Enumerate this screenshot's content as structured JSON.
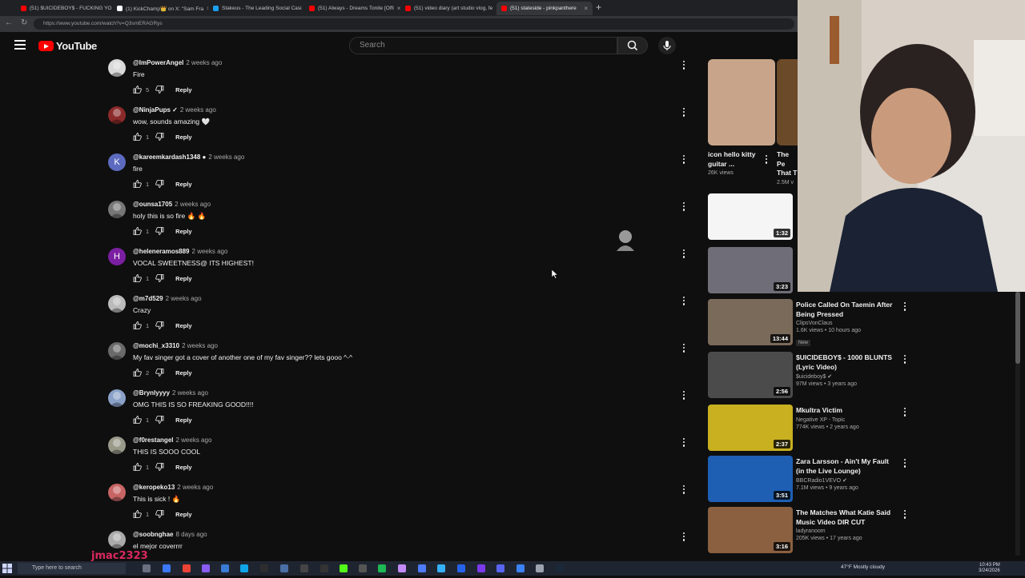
{
  "browser": {
    "tabs": [
      {
        "label": "(51) $UICIDEBOY$ - FUCKING YO",
        "color": "#ff0000",
        "active": false
      },
      {
        "label": "(1) KickChamp👑 on X: \"Sam Fra",
        "color": "#ffffff",
        "active": false
      },
      {
        "label": "Stakeus - The Leading Social Casi",
        "color": "#1da1f2",
        "active": false
      },
      {
        "label": "(51) Always - Dreams Tonite [Offi",
        "color": "#ff0000",
        "active": false
      },
      {
        "label": "(51) video diary (art studio vlog, fe",
        "color": "#ff0000",
        "active": false
      },
      {
        "label": "(51) stateside - pinkpanthere",
        "color": "#ff0000",
        "active": true
      }
    ],
    "new_tab": "+",
    "url": "https://www.youtube.com/watch?v=Q3smERAGRys"
  },
  "youtube": {
    "logo": "YouTube",
    "search_placeholder": "Search"
  },
  "comments": [
    {
      "user": "@ImPowerAngel",
      "time": "2 weeks ago",
      "text": "Fire",
      "likes": "5",
      "avatar": "img",
      "avatar_color": "#d9d9d9"
    },
    {
      "user": "@NinjaPups ✓",
      "time": "2 weeks ago",
      "text": "wow, sounds amazing 🤍",
      "likes": "1",
      "avatar": "img",
      "avatar_color": "#8b2a2a"
    },
    {
      "user": "@kareemkardash1348 ●",
      "time": "2 weeks ago",
      "text": "fire",
      "likes": "1",
      "avatar": "K",
      "avatar_color": "#5c6bc0"
    },
    {
      "user": "@ounsa1705",
      "time": "2 weeks ago",
      "text": "holy this is so fire 🔥 🔥",
      "likes": "1",
      "avatar": "img",
      "avatar_color": "#777777"
    },
    {
      "user": "@heleneramos889",
      "time": "2 weeks ago",
      "text": "VOCAL SWEETNESS@ ITS HIGHEST!",
      "likes": "1",
      "avatar": "H",
      "avatar_color": "#7b1fa2"
    },
    {
      "user": "@m7d529",
      "time": "2 weeks ago",
      "text": "Crazy",
      "likes": "1",
      "avatar": "img",
      "avatar_color": "#bbbbbb"
    },
    {
      "user": "@mochi_x3310",
      "time": "2 weeks ago",
      "text": "My fav singer got a cover of another one of my fav singer?? lets gooo ^-^",
      "likes": "2",
      "avatar": "img",
      "avatar_color": "#6a6a6a"
    },
    {
      "user": "@Brynlyyyy",
      "time": "2 weeks ago",
      "text": "OMG THIS IS SO FREAKING GOOD!!!!",
      "likes": "1",
      "avatar": "img",
      "avatar_color": "#8aa2c8"
    },
    {
      "user": "@f0restangel",
      "time": "2 weeks ago",
      "text": "THIS IS SOOO COOL",
      "likes": "1",
      "avatar": "img",
      "avatar_color": "#9a9a8a"
    },
    {
      "user": "@keropeko13",
      "time": "2 weeks ago",
      "text": "This is sick ! 🔥",
      "likes": "1",
      "avatar": "img",
      "avatar_color": "#c86464"
    },
    {
      "user": "@soobnghae",
      "time": "8 days ago",
      "text": "el mejor coverrrr",
      "likes": "",
      "avatar": "img",
      "avatar_color": "#aaaaaa"
    }
  ],
  "reply_label": "Reply",
  "recommendations": [
    {
      "title": "icon hello kitty guitar ...",
      "stats": "26K views",
      "thumb_color": "#c8a58a",
      "short": true
    },
    {
      "title": "",
      "channel": "",
      "stats": "",
      "duration": "1:32",
      "thumb_color": "#f5f5f5"
    },
    {
      "title": "",
      "channel": "",
      "stats": "",
      "duration": "3:23",
      "thumb_color": "#6f6e78"
    },
    {
      "title": "Police Called On Taemin After Being Pressed",
      "channel": "ClipsVonClaus",
      "stats": "1.6K views • 10 hours ago",
      "badge": "New",
      "duration": "13:44",
      "thumb_color": "#7a6a5a"
    },
    {
      "title": "$UICIDEBOY$ - 1000 BLUNTS (Lyric Video)",
      "channel": "$uicideboy$ ✔",
      "stats": "97M views • 3 years ago",
      "duration": "2:56",
      "thumb_color": "#4b4b4b"
    },
    {
      "title": "Mkultra Victim",
      "channel": "Negative XP - Topic",
      "stats": "774K views • 2 years ago",
      "duration": "2:37",
      "thumb_color": "#c8b020"
    },
    {
      "title": "Zara Larsson - Ain't My Fault (in the Live Lounge)",
      "channel": "BBCRadio1VEVO ✔",
      "stats": "7.1M views • 9 years ago",
      "duration": "3:51",
      "thumb_color": "#1e5fb4"
    },
    {
      "title": "The Matches What Katie Said Music Video DIR CUT",
      "channel": "ladyranoom",
      "stats": "205K views • 17 years ago",
      "duration": "3:16",
      "thumb_color": "#8a6040"
    }
  ],
  "short2": {
    "title": "The Pe That T",
    "stats": "2.5M v"
  },
  "taskbar": {
    "search_placeholder": "Type here to search",
    "weather": "47°F Mostly cloudy",
    "time": "10:43 PM",
    "date": "3/24/2026"
  },
  "watermark": "jmac2323",
  "colors": {
    "background": "#0f0f0f",
    "accent": "#ff0000"
  }
}
